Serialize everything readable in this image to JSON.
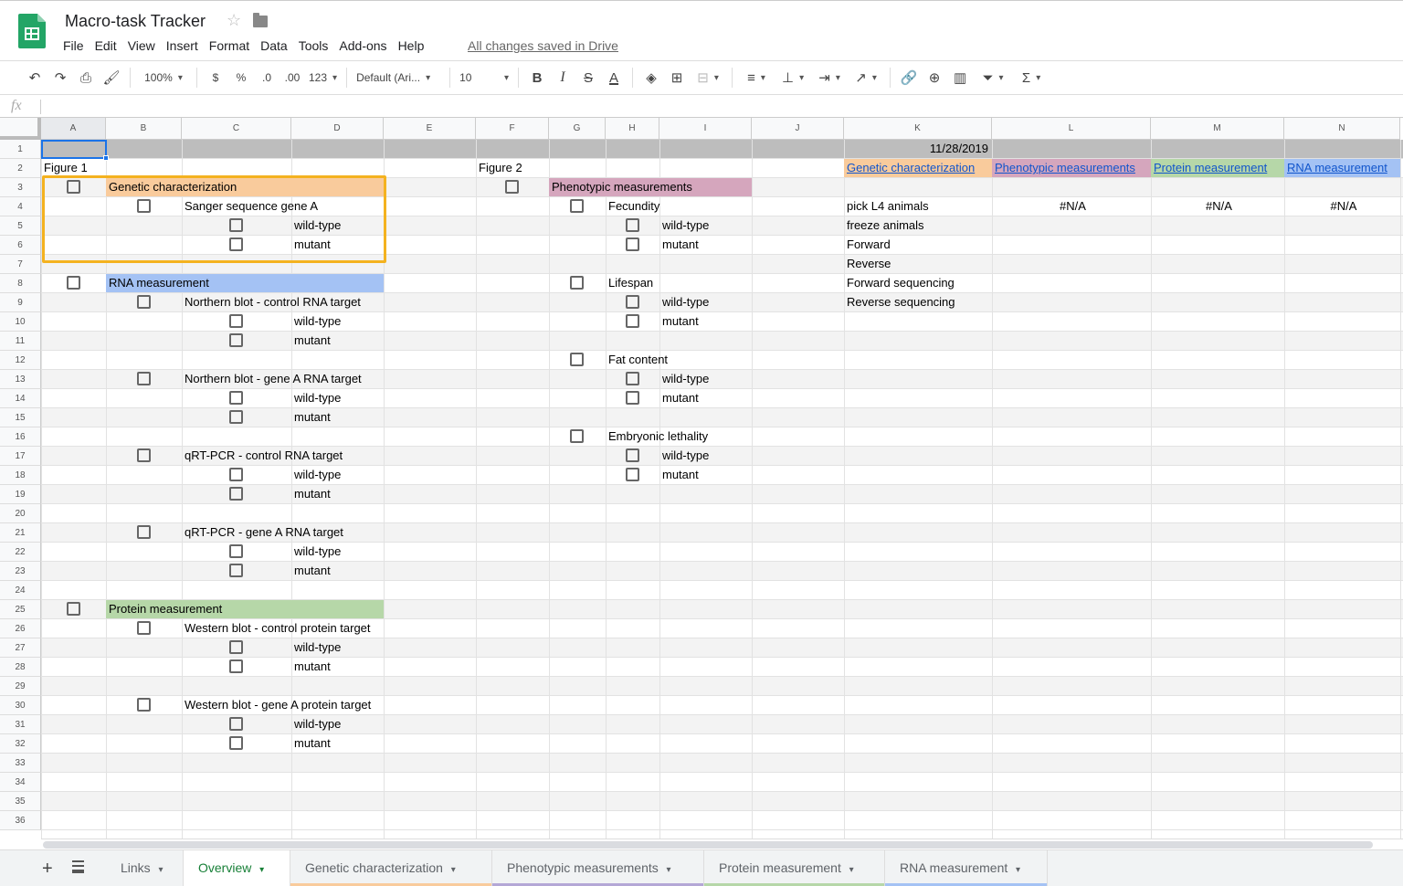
{
  "app": {
    "title": "Macro-task Tracker",
    "menu": [
      "File",
      "Edit",
      "View",
      "Insert",
      "Format",
      "Data",
      "Tools",
      "Add-ons",
      "Help"
    ],
    "save_status": "All changes saved in Drive"
  },
  "toolbar": {
    "zoom": "100%",
    "currency": "$",
    "percent": "%",
    "dec_decrease": ".0",
    "dec_increase": ".00",
    "more_formats": "123",
    "font": "Default (Ari...",
    "font_size": "10",
    "bold": "B",
    "italic": "I",
    "strike": "S",
    "text_color": "A"
  },
  "formula_bar": {
    "label": "fx",
    "value": ""
  },
  "columns": [
    "A",
    "B",
    "C",
    "D",
    "E",
    "F",
    "G",
    "H",
    "I",
    "J",
    "K",
    "L",
    "M",
    "N"
  ],
  "rows": [
    "1",
    "2",
    "3",
    "4",
    "5",
    "6",
    "7",
    "8",
    "9",
    "10",
    "11",
    "12",
    "13",
    "14",
    "15",
    "16",
    "17",
    "18",
    "19",
    "20",
    "21",
    "22",
    "23",
    "24",
    "25",
    "26",
    "27",
    "28",
    "29",
    "30",
    "31",
    "32",
    "33",
    "34",
    "35",
    "36"
  ],
  "colors": {
    "genetic": "#f9cb9c",
    "phenotypic": "#d5a6bd",
    "protein": "#b6d7a8",
    "rna": "#a4c2f4",
    "highlight_box": "#f4b21f",
    "selection": "#1a73e8"
  },
  "cells": {
    "K1": "11/28/2019",
    "A2": "Figure 1",
    "F2": "Figure 2",
    "K2": "Genetic characterization",
    "L2": "Phenotypic measurements",
    "M2": "Protein measurement",
    "N2": "RNA measurement",
    "B3": "Genetic characterization",
    "G3": "Phenotypic measurements",
    "C4": "Sanger sequence gene A",
    "H4": "Fecundity",
    "K4": "pick L4 animals",
    "L4": "#N/A",
    "M4": "#N/A",
    "N4": "#N/A",
    "D5": "wild-type",
    "I5": "wild-type",
    "K5": "freeze animals",
    "D6": "mutant",
    "I6": "mutant",
    "K6": "Forward",
    "K7": "Reverse",
    "B8": "RNA measurement",
    "H8": "Lifespan",
    "K8": "Forward sequencing",
    "C9": "Northern blot - control RNA target",
    "I9": "wild-type",
    "K9": "Reverse sequencing",
    "D10": "wild-type",
    "I10": "mutant",
    "D11": "mutant",
    "H12": "Fat content",
    "C13": "Northern blot - gene A RNA target",
    "I13": "wild-type",
    "D14": "wild-type",
    "I14": "mutant",
    "D15": "mutant",
    "H16": "Embryonic lethality",
    "C17": "qRT-PCR - control RNA target",
    "I17": "wild-type",
    "D18": "wild-type",
    "I18": "mutant",
    "D19": "mutant",
    "C21": "qRT-PCR - gene A RNA target",
    "D22": "wild-type",
    "D23": "mutant",
    "B25": "Protein measurement",
    "C26": "Western blot - control protein target",
    "D27": "wild-type",
    "D28": "mutant",
    "C30": "Western blot - gene A protein target",
    "D31": "wild-type",
    "D32": "mutant"
  },
  "checkboxes": {
    "A3": false,
    "B4": false,
    "C5": false,
    "C6": false,
    "A8": false,
    "B9": false,
    "C10": false,
    "C11": false,
    "B13": false,
    "C14": false,
    "C15": false,
    "B17": false,
    "C18": false,
    "C19": false,
    "B21": false,
    "C22": false,
    "C23": false,
    "A25": false,
    "B26": false,
    "C27": false,
    "C28": false,
    "B30": false,
    "C31": false,
    "C32": false,
    "F3": false,
    "G4": false,
    "H5": false,
    "H6": false,
    "G8": false,
    "H9": false,
    "H10": false,
    "G12": false,
    "H13": false,
    "H14": false,
    "G16": false,
    "H17": false,
    "H18": false
  },
  "selected_cell": "A1",
  "sheet_tabs": [
    {
      "label": "Links",
      "active": false,
      "color": ""
    },
    {
      "label": "Overview",
      "active": true,
      "color": ""
    },
    {
      "label": "Genetic characterization",
      "active": false,
      "color": "#f9cb9c"
    },
    {
      "label": "Phenotypic measurements",
      "active": false,
      "color": "#b4a7d6"
    },
    {
      "label": "Protein measurement",
      "active": false,
      "color": "#b6d7a8"
    },
    {
      "label": "RNA measurement",
      "active": false,
      "color": "#a4c2f4"
    }
  ]
}
